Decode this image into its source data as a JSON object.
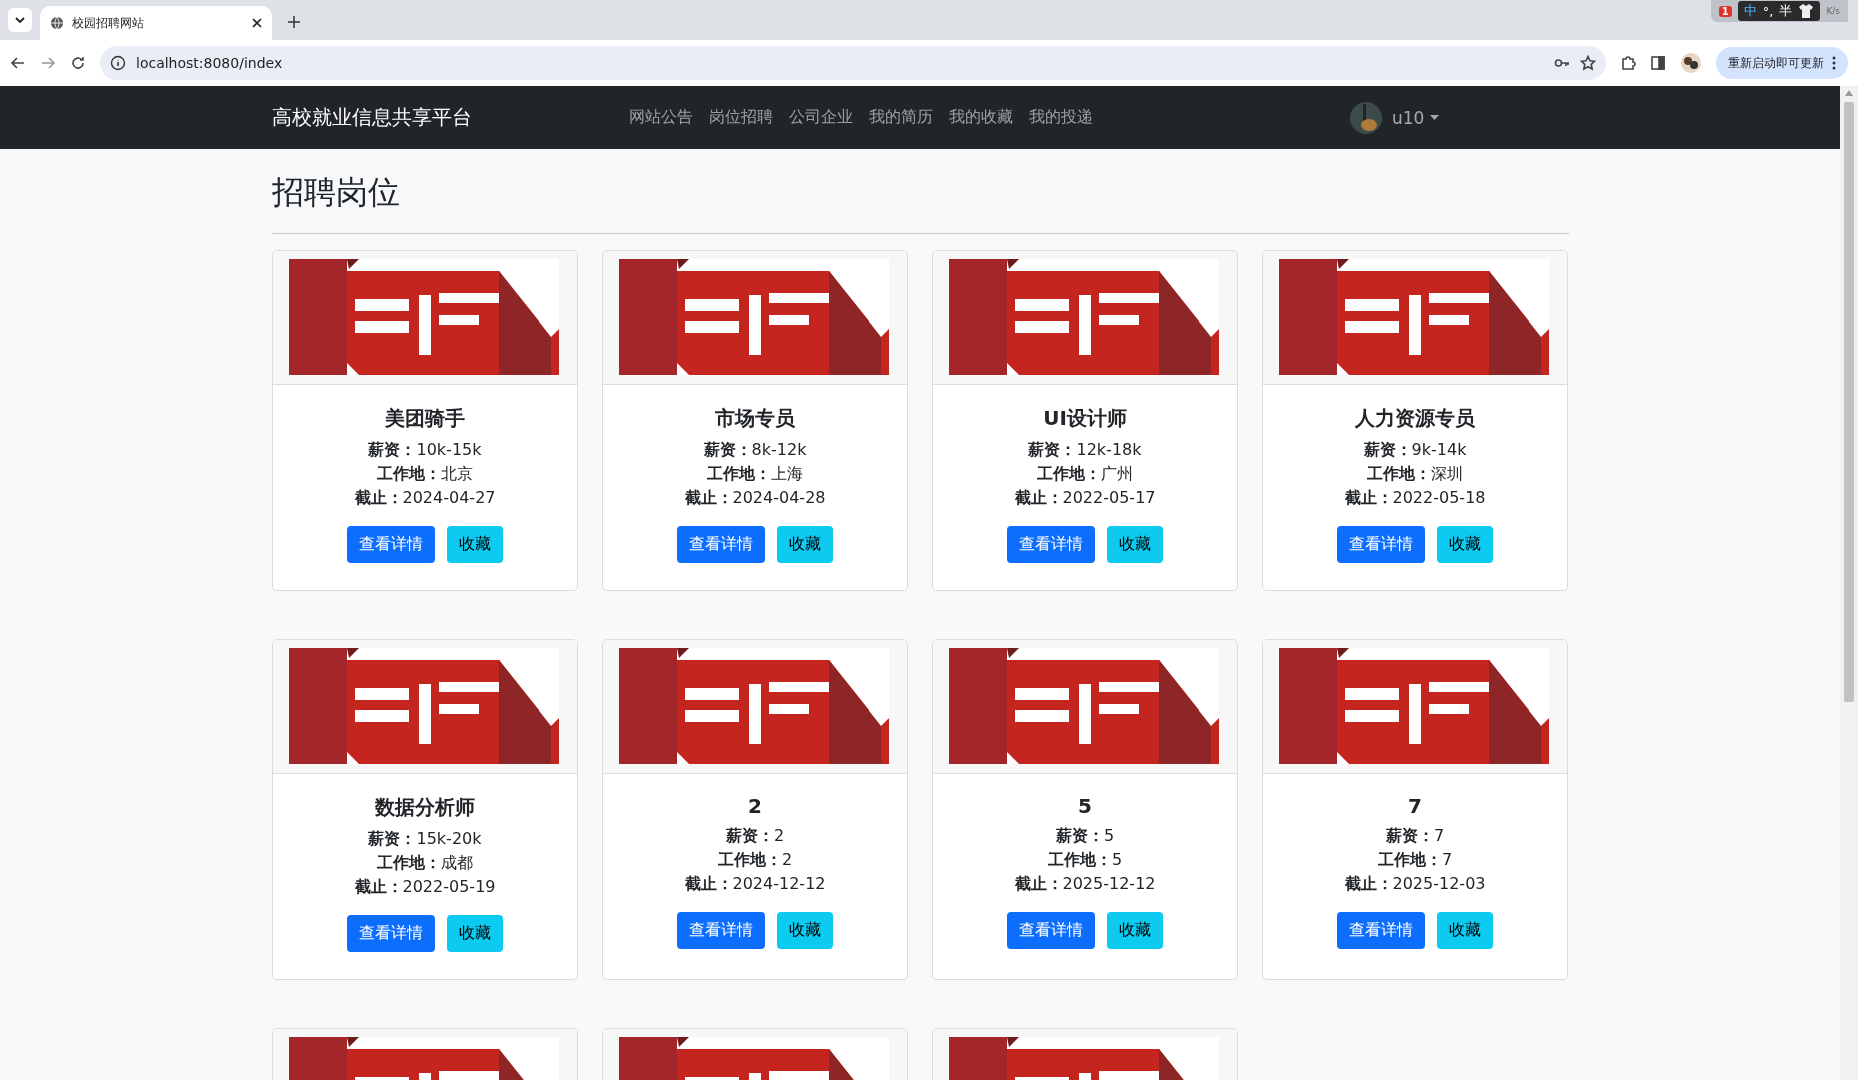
{
  "browser": {
    "tab_title": "校园招聘网站",
    "url": "localhost:8080/index",
    "update_button": "重新启动即可更新",
    "tray": {
      "badge": "1",
      "ime": "中",
      "punct": "°,",
      "width": "半",
      "speed": "K/s"
    }
  },
  "navbar": {
    "brand": "高校就业信息共享平台",
    "links": [
      "网站公告",
      "岗位招聘",
      "公司企业",
      "我的简历",
      "我的收藏",
      "我的投递"
    ],
    "user": "u10"
  },
  "page": {
    "title": "招聘岗位"
  },
  "jobs": [
    {
      "kind": "full",
      "title": "美团骑手",
      "fields": [
        {
          "label": "薪资：",
          "value": "10k-15k"
        },
        {
          "label": "工作地：",
          "value": "北京"
        },
        {
          "label": "截止：",
          "value": "2024-04-27"
        }
      ],
      "buttons": [
        "查看详情",
        "收藏"
      ]
    },
    {
      "kind": "full",
      "title": "市场专员",
      "fields": [
        {
          "label": "薪资：",
          "value": "8k-12k"
        },
        {
          "label": "工作地：",
          "value": "上海"
        },
        {
          "label": "截止：",
          "value": "2024-04-28"
        }
      ],
      "buttons": [
        "查看详情",
        "收藏"
      ]
    },
    {
      "kind": "full",
      "title": "UI设计师",
      "fields": [
        {
          "label": "薪资：",
          "value": "12k-18k"
        },
        {
          "label": "工作地：",
          "value": "广州"
        },
        {
          "label": "截止：",
          "value": "2022-05-17"
        }
      ],
      "buttons": [
        "查看详情",
        "收藏"
      ]
    },
    {
      "kind": "full",
      "title": "人力资源专员",
      "fields": [
        {
          "label": "薪资：",
          "value": "9k-14k"
        },
        {
          "label": "工作地：",
          "value": "深圳"
        },
        {
          "label": "截止：",
          "value": "2022-05-18"
        }
      ],
      "buttons": [
        "查看详情",
        "收藏"
      ]
    },
    {
      "kind": "full",
      "title": "数据分析师",
      "fields": [
        {
          "label": "薪资：",
          "value": "15k-20k"
        },
        {
          "label": "工作地：",
          "value": "成都"
        },
        {
          "label": "截止：",
          "value": "2022-05-19"
        }
      ],
      "buttons": [
        "查看详情",
        "收藏"
      ]
    },
    {
      "kind": "full",
      "title": "2",
      "fields": [
        {
          "label": "薪资：",
          "value": "2"
        },
        {
          "label": "工作地：",
          "value": "2"
        },
        {
          "label": "截止：",
          "value": "2024-12-12"
        }
      ],
      "buttons": [
        "查看详情",
        "收藏"
      ]
    },
    {
      "kind": "full",
      "title": "5",
      "fields": [
        {
          "label": "薪资：",
          "value": "5"
        },
        {
          "label": "工作地：",
          "value": "5"
        },
        {
          "label": "截止：",
          "value": "2025-12-12"
        }
      ],
      "buttons": [
        "查看详情",
        "收藏"
      ]
    },
    {
      "kind": "full",
      "title": "7",
      "fields": [
        {
          "label": "薪资：",
          "value": "7"
        },
        {
          "label": "工作地：",
          "value": "7"
        },
        {
          "label": "截止：",
          "value": "2025-12-03"
        }
      ],
      "buttons": [
        "查看详情",
        "收藏"
      ]
    },
    {
      "kind": "partial"
    },
    {
      "kind": "partial"
    },
    {
      "kind": "partial"
    }
  ]
}
